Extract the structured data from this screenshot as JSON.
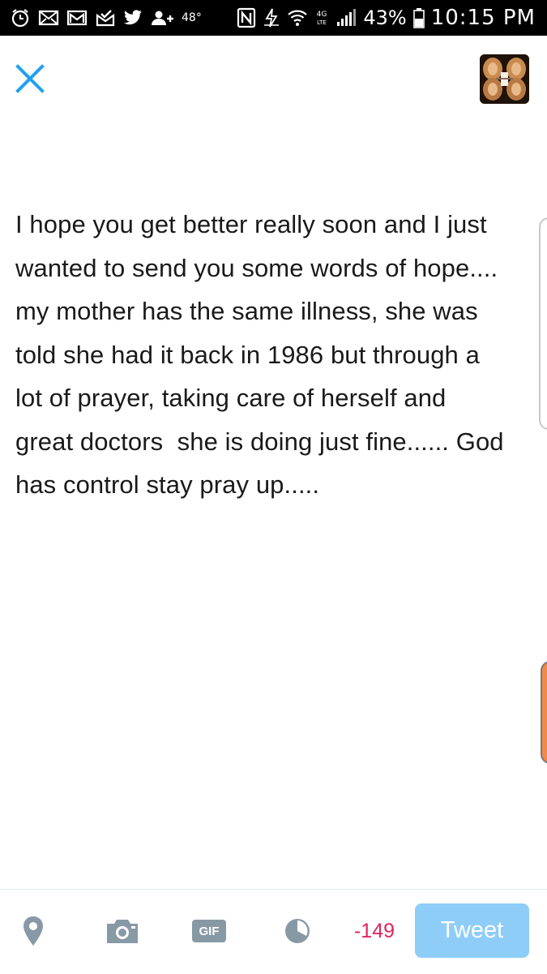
{
  "status_bar": {
    "temperature": "48°",
    "battery_percent": "43%",
    "time": "10:15 PM",
    "icons_left": [
      "alarm-icon",
      "email-icon",
      "gmail-icon",
      "inbox-check-icon",
      "twitter-icon",
      "add-person-icon"
    ],
    "icons_right": [
      "nfc-icon",
      "data-icon",
      "wifi-icon",
      "4g-lte-icon",
      "signal-icon",
      "battery-icon"
    ]
  },
  "header": {
    "close_icon": "close-icon",
    "avatar": "profile-avatar"
  },
  "compose": {
    "text": "I hope you get better really soon and I just\nwanted to send you some words of hope....\nmy mother has the same illness, she was\ntold she had it back in 1986 but through a\nlot of prayer, taking care of herself and\ngreat doctors  she is doing just fine...... God\nhas control stay pray up....."
  },
  "toolbar": {
    "location_icon": "location-pin-icon",
    "camera_icon": "camera-icon",
    "gif_label": "GIF",
    "poll_icon": "poll-icon",
    "char_counter": "-149",
    "tweet_label": "Tweet"
  },
  "colors": {
    "accent": "#1da1f2",
    "tweet_button_disabled": "#8ecdf8",
    "counter_negative": "#e0245e",
    "toolbar_icon": "#8899a6"
  }
}
